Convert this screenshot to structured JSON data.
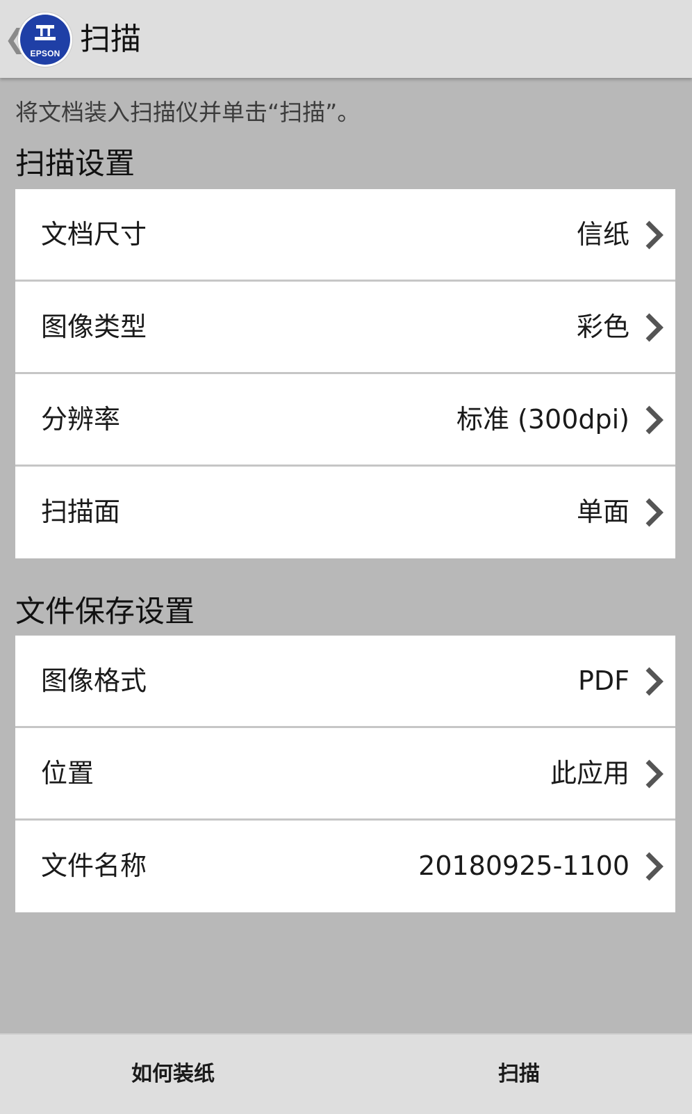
{
  "header": {
    "back_icon": "chevron-left-icon",
    "logo_brand": "EPSON",
    "title": "扫描"
  },
  "instruction": "将文档装入扫描仪并单击“扫描”。",
  "sections": [
    {
      "title": "扫描设置",
      "rows": [
        {
          "label": "文档尺寸",
          "value": "信纸"
        },
        {
          "label": "图像类型",
          "value": "彩色"
        },
        {
          "label": "分辨率",
          "value": "标准 (300dpi)"
        },
        {
          "label": "扫描面",
          "value": "单面"
        }
      ]
    },
    {
      "title": "文件保存设置",
      "rows": [
        {
          "label": "图像格式",
          "value": "PDF"
        },
        {
          "label": "位置",
          "value": "此应用"
        },
        {
          "label": "文件名称",
          "value": "20180925-1100"
        }
      ]
    }
  ],
  "bottom_bar": {
    "how_to_load_label": "如何装纸",
    "scan_label": "扫描"
  },
  "colors": {
    "background": "#b8b8b8",
    "bar": "#dedede",
    "logo_blue": "#1f3fa6",
    "chevron": "#555555"
  }
}
